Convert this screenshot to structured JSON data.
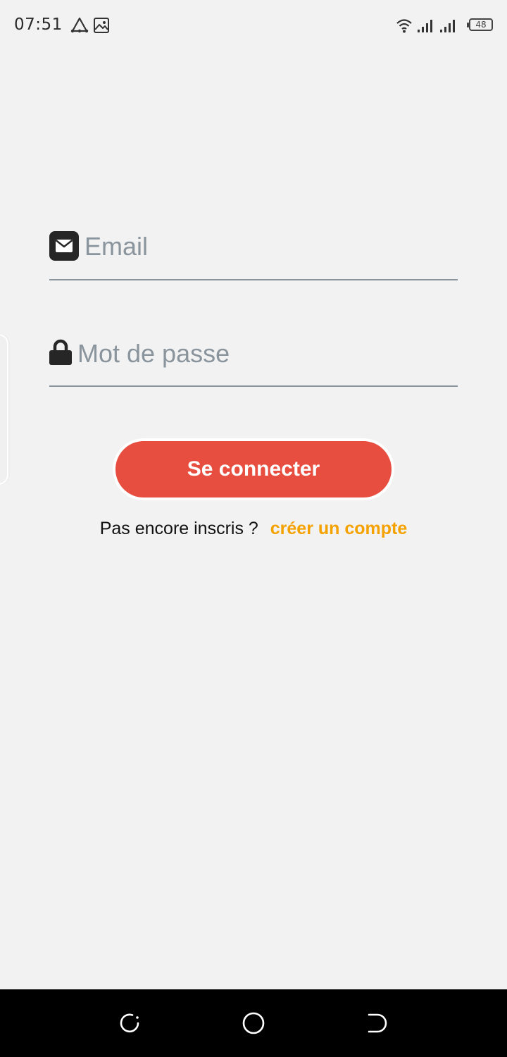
{
  "status_bar": {
    "time": "07:51",
    "battery": "48",
    "icons": [
      "alert-triangle-icon",
      "gallery-icon",
      "wifi-icon",
      "signal-icon",
      "signal-icon",
      "battery-icon"
    ]
  },
  "login": {
    "email_placeholder": "Email",
    "password_placeholder": "Mot de passe",
    "submit_label": "Se connecter",
    "signup_prompt": "Pas encore inscris ?",
    "signup_link": "créer un compte"
  },
  "nav_bar": {
    "icons": [
      "recent-apps-icon",
      "home-icon",
      "back-icon"
    ]
  },
  "colors": {
    "background": "#f2f2f2",
    "button": "#e84e3f",
    "link": "#f5a100",
    "placeholder": "#8a949c",
    "nav_bar": "#000000"
  }
}
